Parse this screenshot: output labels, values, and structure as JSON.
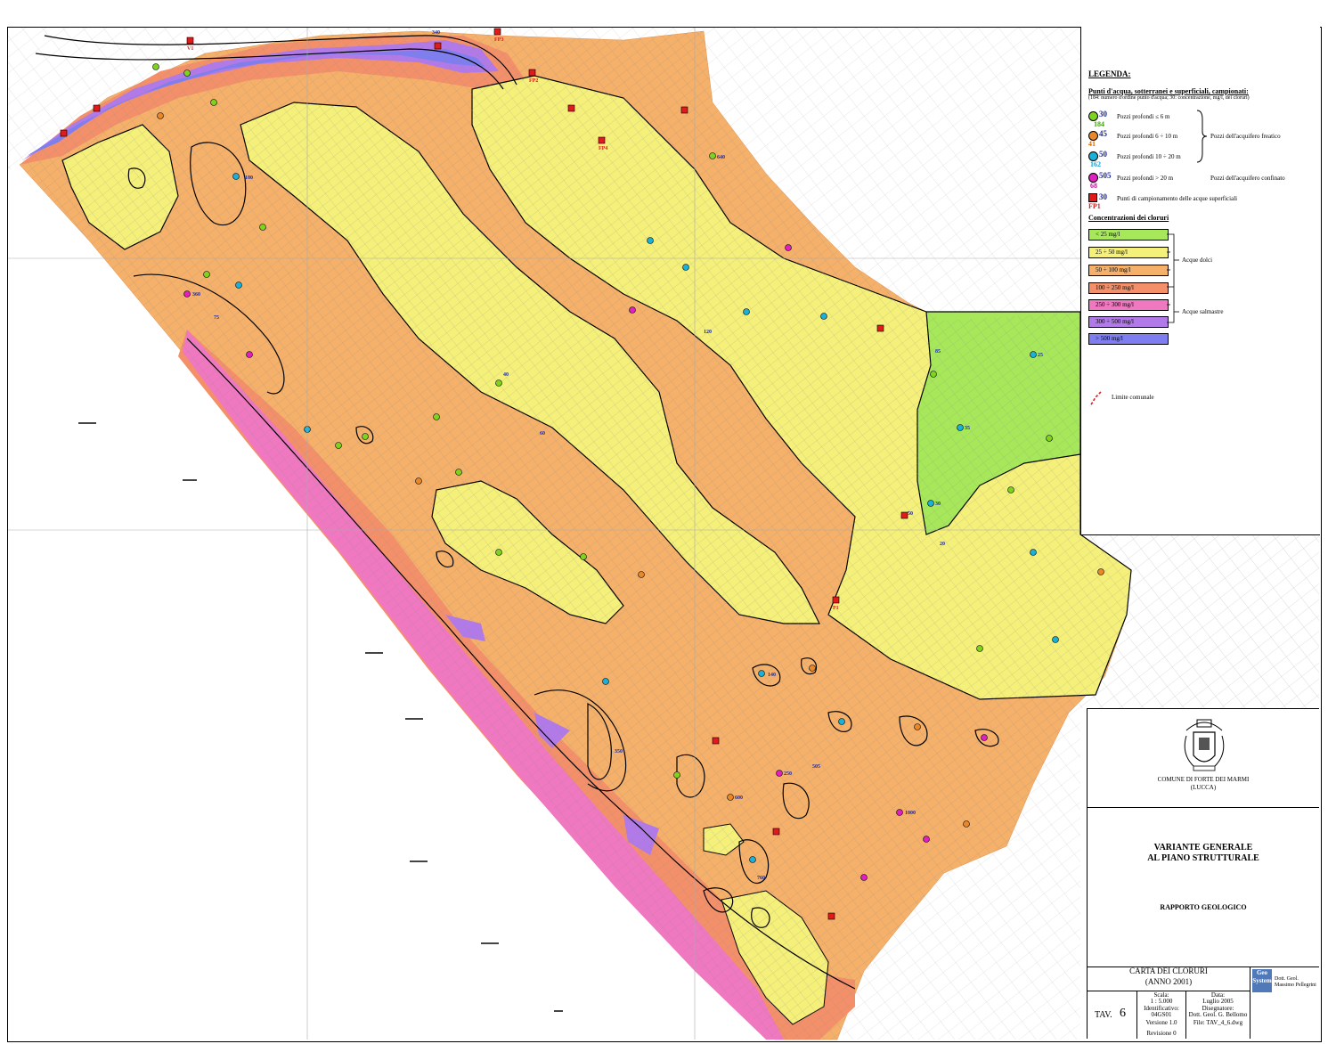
{
  "legend": {
    "title": "LEGENDA:",
    "water_points_title": "Punti d'acqua, sotterranei e superficiali, campionati:",
    "water_points_note": "(184: numero d'ordine punto d'acqua; 30: concentrazione, mg/l, dei cloruri)",
    "point_types": [
      {
        "value": "30",
        "id": "184",
        "label": "Pozzi profondi ≤ 6 m",
        "color": "#7ed321",
        "id_color": "#3aa800"
      },
      {
        "value": "45",
        "id": "41",
        "label": "Pozzi profondi 6 ÷ 10 m",
        "color": "#e8882a",
        "id_color": "#d96a00"
      },
      {
        "value": "50",
        "id": "162",
        "label": "Pozzi profondi 10 ÷ 20 m",
        "color": "#1ab0d8",
        "id_color": "#1a9fcf"
      },
      {
        "value": "505",
        "id": "68",
        "label": "Pozzi profondi > 20 m",
        "color": "#e020c0",
        "id_color": "#c0109a"
      },
      {
        "value": "30",
        "id": "FP1",
        "label": "Punti di campionamento delle acque superficiali",
        "color": "#e21a1a",
        "id_color": "#e21a1a"
      }
    ],
    "group_phreatic": "Pozzi dell'acquifero freatico",
    "group_confined": "Pozzi dell'acquifero confinato",
    "concentrations_title": "Concentrazioni dei cloruri",
    "classes": [
      {
        "label": "< 25 mg/l",
        "color": "#a6e85a"
      },
      {
        "label": "25 ÷ 50 mg/l",
        "color": "#f5f07a"
      },
      {
        "label": "50 ÷ 100 mg/l",
        "color": "#f5b06a"
      },
      {
        "label": "100 ÷ 250 mg/l",
        "color": "#f3906a"
      },
      {
        "label": "250 ÷ 300 mg/l",
        "color": "#ef78c0"
      },
      {
        "label": "300 ÷ 500 mg/l",
        "color": "#b27ae8"
      },
      {
        "label": "> 500 mg/l",
        "color": "#7f7ef0"
      }
    ],
    "group_fresh": "Acque dolci",
    "group_brackish": "Acque salmastre",
    "boundary_label": "Limite comunale"
  },
  "title_block": {
    "municipality": "COMUNE DI FORTE DEI MARMI",
    "province": "(LUCCA)",
    "project_line1": "VARIANTE GENERALE",
    "project_line2": "AL PIANO STRUTTURALE",
    "report": "RAPPORTO GEOLOGICO",
    "map_title": "CARTA DEI CLORURI",
    "map_year": "(ANNO 2001)",
    "company_logo": "Geo System",
    "author": "Dott. Geol. Massimo Pellegrini",
    "tav_label": "TAV.",
    "tav_number": "6",
    "scale_label": "Scala:",
    "scale": "1 : 5.000",
    "date_label": "Data:",
    "date": "Luglio 2005",
    "identifier_label": "Identificativo:",
    "identifier": "04GS01",
    "drawer_label": "Disegnatore:",
    "drawer": "Dott. Geol. G. Bellomo",
    "version": "Versione 1.0",
    "file": "File: TAV_4_6.dwg",
    "revision": "Revisione 0"
  },
  "map_labels": [
    {
      "text": "340",
      "color": "#1a2aa8"
    },
    {
      "text": "V1",
      "color": "#e21a1a"
    },
    {
      "text": "FP2",
      "color": "#e21a1a"
    },
    {
      "text": "FP3",
      "color": "#e21a1a"
    },
    {
      "text": "FP4",
      "color": "#e21a1a"
    },
    {
      "text": "P1",
      "color": "#e21a1a"
    },
    {
      "text": "640",
      "color": "#1a2aa8"
    },
    {
      "text": "180",
      "color": "#1a2aa8"
    },
    {
      "text": "360",
      "color": "#1a2aa8"
    },
    {
      "text": "350",
      "color": "#1a2aa8"
    },
    {
      "text": "1000",
      "color": "#1a2aa8"
    },
    {
      "text": "760",
      "color": "#1a2aa8"
    },
    {
      "text": "600",
      "color": "#1a2aa8"
    },
    {
      "text": "250",
      "color": "#1a2aa8"
    },
    {
      "text": "505",
      "color": "#1a2aa8"
    },
    {
      "text": "140",
      "color": "#1a2aa8"
    },
    {
      "text": "120",
      "color": "#1a2aa8"
    },
    {
      "text": "85",
      "color": "#1a2aa8"
    },
    {
      "text": "75",
      "color": "#1a2aa8"
    },
    {
      "text": "60",
      "color": "#1a2aa8"
    },
    {
      "text": "50",
      "color": "#1a2aa8"
    },
    {
      "text": "40",
      "color": "#1a2aa8"
    },
    {
      "text": "35",
      "color": "#1a2aa8"
    },
    {
      "text": "30",
      "color": "#1a2aa8"
    },
    {
      "text": "25",
      "color": "#1a2aa8"
    },
    {
      "text": "20",
      "color": "#1a2aa8"
    }
  ]
}
